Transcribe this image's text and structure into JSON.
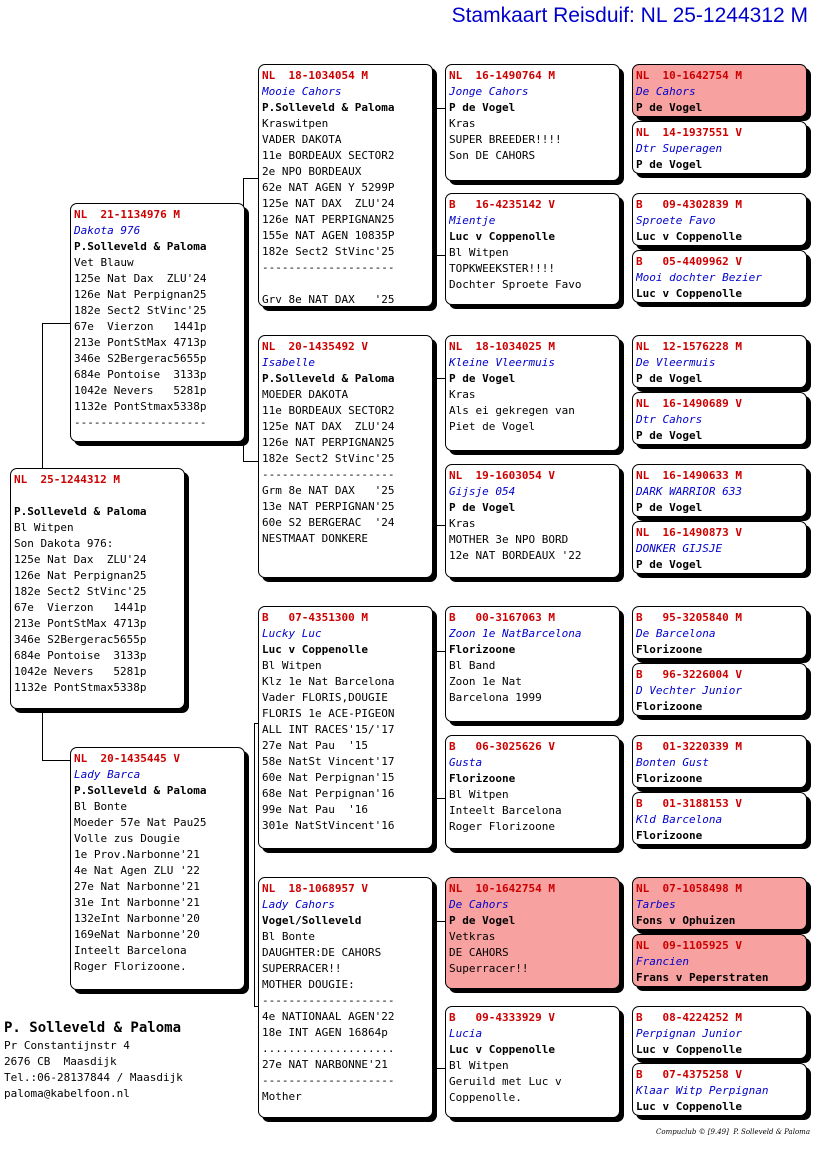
{
  "title": "Stamkaart Reisduif: NL  25-1244312 M",
  "breeder": {
    "name": "P. Solleveld & Paloma",
    "lines": [
      "Pr Constantijnstr 4",
      "2676 CB  Maasdijk",
      "Tel.:06-28137844 / Maasdijk",
      "paloma@kabelfoon.nl"
    ]
  },
  "footer": "Compuclub © [9.49]  P. Solleveld & Paloma",
  "cards": {
    "g0": {
      "ring": "NL  25-1244312 M",
      "name": "",
      "owner": "P.Solleveld & Paloma",
      "details": [
        "Bl Witpen",
        "Son Dakota 976:",
        "125e Nat Dax  ZLU'24",
        "126e Nat Perpignan25",
        "182e Sect2 StVinc'25",
        "67e  Vierzon   1441p",
        "213e PontStMax 4713p",
        "346e S2Bergerac5655p",
        "684e Pontoise  3133p",
        "1042e Nevers   5281p",
        "1132e PontStmax5338p"
      ]
    },
    "f": {
      "ring": "NL  21-1134976 M",
      "name": "Dakota 976",
      "owner": "P.Solleveld & Paloma",
      "details": [
        "Vet Blauw",
        "125e Nat Dax  ZLU'24",
        "126e Nat Perpignan25",
        "182e Sect2 StVinc'25",
        "67e  Vierzon   1441p",
        "213e PontStMax 4713p",
        "346e S2Bergerac5655p",
        "684e Pontoise  3133p",
        "1042e Nevers   5281p",
        "1132e PontStmax5338p",
        "--------------------"
      ]
    },
    "m": {
      "ring": "NL  20-1435445 V",
      "name": "Lady Barca",
      "owner": "P.Solleveld & Paloma",
      "details": [
        "Bl Bonte",
        "Moeder 57e Nat Pau25",
        "Volle zus Dougie",
        "1e Prov.Narbonne'21",
        "4e Nat Agen ZLU '22",
        "27e Nat Narbonne'21",
        "31e Int Narbonne'21",
        "132eInt Narbonne'20",
        "169eNat Narbonne'20",
        "Inteelt Barcelona",
        "Roger Florizoone."
      ]
    },
    "ff": {
      "ring": "NL  18-1034054 M",
      "name": "Mooie Cahors",
      "owner": "P.Solleveld & Paloma",
      "details": [
        "Kraswitpen",
        "VADER DAKOTA",
        "11e BORDEAUX SECTOR2",
        "2e NPO BORDEAUX",
        "62e NAT AGEN Y 5299P",
        "125e NAT DAX  ZLU'24",
        "126e NAT PERPIGNAN25",
        "155e NAT AGEN 10835P",
        "182e Sect2 StVinc'25",
        "--------------------",
        "",
        "Grv 8e NAT DAX   '25"
      ]
    },
    "fm": {
      "ring": "NL  20-1435492 V",
      "name": "Isabelle",
      "owner": "P.Solleveld & Paloma",
      "details": [
        "MOEDER DAKOTA",
        "11e BORDEAUX SECTOR2",
        "125e NAT DAX  ZLU'24",
        "126e NAT PERPIGNAN25",
        "182e Sect2 StVinc'25",
        "--------------------",
        "Grm 8e NAT DAX   '25",
        "13e NAT PERPIGNAN'25",
        "60e S2 BERGERAC  '24",
        "NESTMAAT DONKERE"
      ]
    },
    "mf": {
      "ring": "B   07-4351300 M",
      "name": "Lucky Luc",
      "owner": "Luc v Coppenolle",
      "details": [
        "Bl Witpen",
        "Klz 1e Nat Barcelona",
        "Vader FLORIS,DOUGIE",
        "FLORIS 1e ACE-PIGEON",
        "ALL INT RACES'15/'17",
        "27e Nat Pau  '15",
        "58e NatSt Vincent'17",
        "60e Nat Perpignan'15",
        "68e Nat Perpignan'16",
        "99e Nat Pau  '16",
        "301e NatStVincent'16"
      ]
    },
    "mm": {
      "ring": "NL  18-1068957 V",
      "name": "Lady Cahors",
      "owner": "Vogel/Solleveld",
      "details": [
        "Bl Bonte",
        "DAUGHTER:DE CAHORS",
        "SUPERRACER!!",
        "MOTHER DOUGIE:",
        "--------------------",
        "4e NATIONAAL AGEN'22",
        "18e INT AGEN 16864p",
        "....................",
        "27e NAT NARBONNE'21",
        "--------------------",
        "Mother"
      ]
    },
    "fff": {
      "ring": "NL  16-1490764 M",
      "name": "Jonge Cahors",
      "owner": "P de Vogel",
      "details": [
        "Kras",
        "SUPER BREEDER!!!!",
        "Son DE CAHORS"
      ]
    },
    "ffm": {
      "ring": "B   16-4235142 V",
      "name": "Mientje",
      "owner": "Luc v Coppenolle",
      "details": [
        "Bl Witpen",
        "TOPKWEEKSTER!!!!",
        "Dochter Sproete Favo"
      ]
    },
    "fmf": {
      "ring": "NL  18-1034025 M",
      "name": "Kleine Vleermuis",
      "owner": "P de Vogel",
      "details": [
        "Kras",
        "Als ei gekregen van",
        "Piet de Vogel"
      ]
    },
    "fmm": {
      "ring": "NL  19-1603054 V",
      "name": "Gijsje 054",
      "owner": "P de Vogel",
      "details": [
        "Kras",
        "MOTHER 3e NPO BORD",
        "12e NAT BORDEAUX '22"
      ]
    },
    "mff": {
      "ring": "B   00-3167063 M",
      "name": "Zoon 1e NatBarcelona",
      "owner": "Florizoone",
      "details": [
        "Bl Band",
        "Zoon 1e Nat",
        "Barcelona 1999"
      ]
    },
    "mfm": {
      "ring": "B   06-3025626 V",
      "name": "Gusta",
      "owner": "Florizoone",
      "details": [
        "Bl Witpen",
        "Inteelt Barcelona",
        "Roger Florizoone"
      ]
    },
    "mmf": {
      "ring": "NL  10-1642754 M",
      "name": "De Cahors",
      "owner": "P de Vogel",
      "details": [
        "Vetkras",
        "DE CAHORS",
        "Superracer!!"
      ]
    },
    "mmm": {
      "ring": "B   09-4333929 V",
      "name": "Lucia",
      "owner": "Luc v Coppenolle",
      "details": [
        "Bl Witpen",
        "Geruild met Luc v",
        "Coppenolle."
      ]
    },
    "g4_1": {
      "ring": "NL  10-1642754 M",
      "name": "De Cahors",
      "owner": "P de Vogel",
      "details": []
    },
    "g4_2": {
      "ring": "NL  14-1937551 V",
      "name": "Dtr Superagen",
      "owner": "P de Vogel",
      "details": []
    },
    "g4_3": {
      "ring": "B   09-4302839 M",
      "name": "Sproete Favo",
      "owner": "Luc v Coppenolle",
      "details": []
    },
    "g4_4": {
      "ring": "B   05-4409962 V",
      "name": "Mooi dochter Bezier",
      "owner": "Luc v Coppenolle",
      "details": []
    },
    "g4_5": {
      "ring": "NL  12-1576228 M",
      "name": "De Vleermuis",
      "owner": "P de Vogel",
      "details": []
    },
    "g4_6": {
      "ring": "NL  16-1490689 V",
      "name": "Dtr Cahors",
      "owner": "P de Vogel",
      "details": []
    },
    "g4_7": {
      "ring": "NL  16-1490633 M",
      "name": "DARK WARRIOR 633",
      "owner": "P de Vogel",
      "details": []
    },
    "g4_8": {
      "ring": "NL  16-1490873 V",
      "name": "DONKER GIJSJE",
      "owner": "P de Vogel",
      "details": []
    },
    "g4_9": {
      "ring": "B   95-3205840 M",
      "name": "De Barcelona",
      "owner": "Florizoone",
      "details": []
    },
    "g4_10": {
      "ring": "B   96-3226004 V",
      "name": "D Vechter Junior",
      "owner": "Florizoone",
      "details": []
    },
    "g4_11": {
      "ring": "B   01-3220339 M",
      "name": "Bonten Gust",
      "owner": "Florizoone",
      "details": []
    },
    "g4_12": {
      "ring": "B   01-3188153 V",
      "name": "Kld Barcelona",
      "owner": "Florizoone",
      "details": []
    },
    "g4_13": {
      "ring": "NL  07-1058498 M",
      "name": "Tarbes",
      "owner": "Fons v Ophuizen",
      "details": []
    },
    "g4_14": {
      "ring": "NL  09-1105925 V",
      "name": "Francien",
      "owner": "Frans v Peperstraten",
      "details": []
    },
    "g4_15": {
      "ring": "B   08-4224252 M",
      "name": "Perpignan Junior",
      "owner": "Luc v Coppenolle",
      "details": []
    },
    "g4_16": {
      "ring": "B   07-4375258 V",
      "name": "Klaar Witp Perpignan",
      "owner": "Luc v Coppenolle",
      "details": []
    }
  }
}
